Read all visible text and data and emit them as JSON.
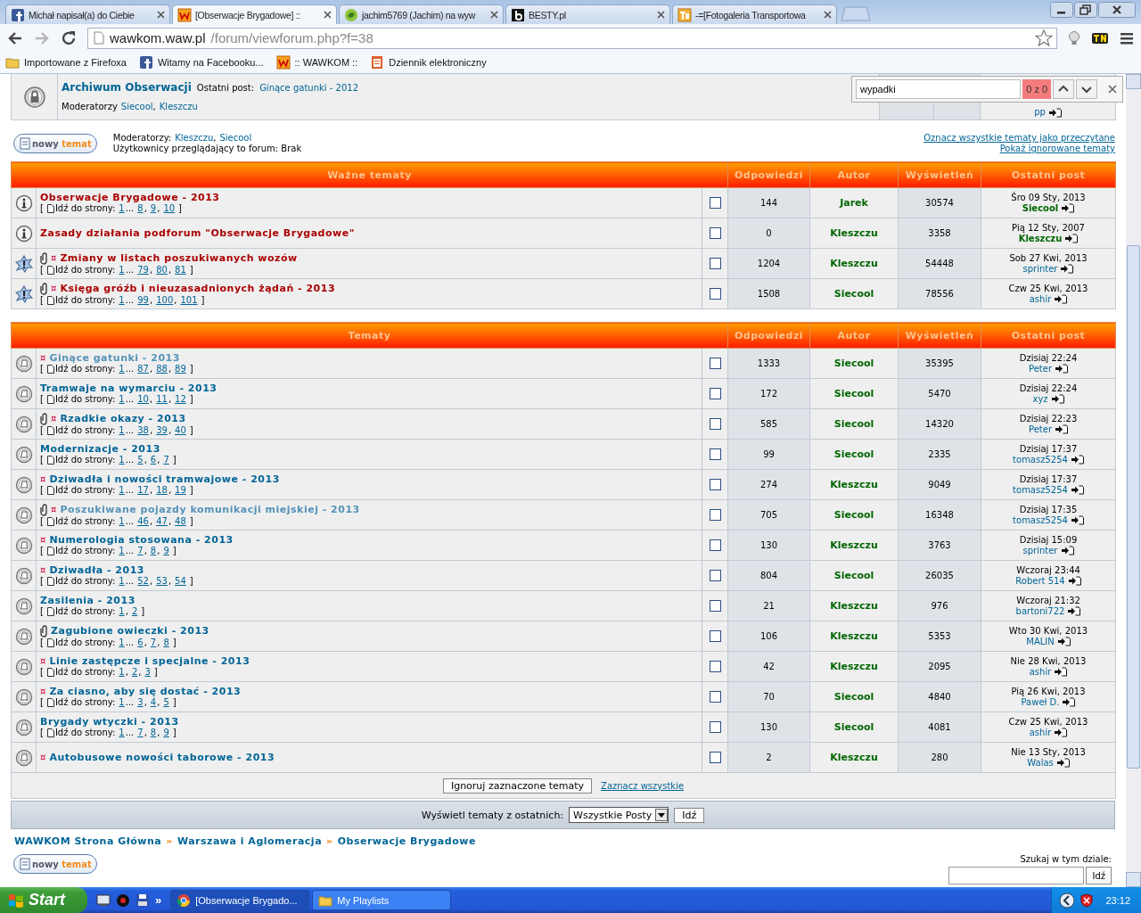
{
  "browser": {
    "tabs": [
      {
        "title": "Michał napisał(a) do Ciebie",
        "kind": "facebook",
        "selected": false
      },
      {
        "title": "[Obserwacje Brygadowe] ::",
        "kind": "wawkom",
        "selected": true
      },
      {
        "title": "jachim5769 (Jachim) na wyw",
        "kind": "green",
        "selected": false
      },
      {
        "title": "BESTY.pl",
        "kind": "b",
        "selected": false
      },
      {
        "title": "-=[Fotogaleria Transportowa",
        "kind": "tp",
        "selected": false
      }
    ],
    "address": {
      "host": "wawkom.waw.pl",
      "path": "/forum/viewforum.php?f=38"
    },
    "bookmarks": [
      {
        "label": "Importowane z Firefoxa",
        "kind": "folder"
      },
      {
        "label": "Witamy na Facebooku...",
        "kind": "facebook"
      },
      {
        "label": ":: WAWKOM ::",
        "kind": "wawkom"
      },
      {
        "label": "Dziennik elektroniczny",
        "kind": "dziennik"
      }
    ]
  },
  "find_bar": {
    "value": "wypadki",
    "count": "0 z 0"
  },
  "archive_forum": {
    "title": "Archiwum Obserwacji",
    "last_post_label": "Ostatni post:",
    "last_post": "Ginące gatunki - 2012",
    "moderators_label": "Moderatorzy",
    "moderators": [
      "Siecool",
      "Kleszczu"
    ],
    "separator": ",",
    "last_user": "pp"
  },
  "forum_info": {
    "new_topic": "nowy **temat**",
    "moderators_label": "Moderatorzy:",
    "moderators": [
      "Kleszczu",
      "Siecool"
    ],
    "separator": ",",
    "viewers": "Użytkownicy przeglądający to forum: Brak",
    "links": [
      "Oznacz wszystkie tematy jako przeczytane",
      "Pokaż ignorowane tematy"
    ]
  },
  "tables": [
    {
      "columns": [
        "Ważne tematy",
        "Odpowiedzi",
        "Autor",
        "Wyświetleń",
        "Ostatni post"
      ],
      "rows": [
        {
          "kind": "info",
          "attachment": false,
          "title": "Obserwacje Brygadowe - 2013",
          "visited": false,
          "pages": {
            "open": "[",
            "label": "Idź do strony:",
            "items": [
              {
                "t": "1",
                "link": true
              },
              {
                "t": "...",
                "link": false
              },
              {
                "t": "8",
                "link": true
              },
              {
                "t": ",",
                "link": false
              },
              {
                "t": "9",
                "link": true
              },
              {
                "t": ",",
                "link": false
              },
              {
                "t": "10",
                "link": true
              }
            ],
            "close": "]"
          },
          "checked": false,
          "replies": "144",
          "author": "Jarek",
          "views": "30574",
          "last_date": "Śro 09 Sty, 2013",
          "last_user": "Siecool",
          "moderator": true
        },
        {
          "kind": "info",
          "attachment": false,
          "title": "Zasady działania podforum \"Obserwacje Brygadowe\"",
          "visited": false,
          "checked": false,
          "replies": "0",
          "author": "Kleszczu",
          "views": "3358",
          "last_date": "Pią 12 Sty, 2007",
          "last_user": "Kleszczu",
          "moderator": true
        },
        {
          "kind": "sticky",
          "attachment": true,
          "mark": "¤",
          "title": "Zmiany w listach poszukiwanych wozów",
          "visited": false,
          "pages": {
            "open": "[",
            "label": "Idź do strony:",
            "items": [
              {
                "t": "1",
                "link": true
              },
              {
                "t": "...",
                "link": false
              },
              {
                "t": "79",
                "link": true
              },
              {
                "t": ",",
                "link": false
              },
              {
                "t": "80",
                "link": true
              },
              {
                "t": ",",
                "link": false
              },
              {
                "t": "81",
                "link": true
              }
            ],
            "close": "]"
          },
          "checked": false,
          "replies": "1204",
          "author": "Kleszczu",
          "views": "54448",
          "last_date": "Sob 27 Kwi, 2013",
          "last_user": "sprinter",
          "moderator": false
        },
        {
          "kind": "sticky",
          "attachment": true,
          "mark": "¤",
          "title": "Księga gróźb i nieuzasadnionych żądań - 2013",
          "visited": false,
          "pages": {
            "open": "[",
            "label": "Idź do strony:",
            "items": [
              {
                "t": "1",
                "link": true
              },
              {
                "t": "...",
                "link": false
              },
              {
                "t": "99",
                "link": true
              },
              {
                "t": ",",
                "link": false
              },
              {
                "t": "100",
                "link": true
              },
              {
                "t": ",",
                "link": false
              },
              {
                "t": "101",
                "link": true
              }
            ],
            "close": "]"
          },
          "checked": false,
          "replies": "1508",
          "author": "Siecool",
          "views": "78556",
          "last_date": "Czw 25 Kwi, 2013",
          "last_user": "ashir",
          "moderator": false
        }
      ]
    },
    {
      "columns": [
        "Tematy",
        "Odpowiedzi",
        "Autor",
        "Wyświetleń",
        "Ostatni post"
      ],
      "rows": [
        {
          "kind": "topic",
          "attachment": false,
          "mark": "¤",
          "title": "Ginące gatunki - 2013",
          "visited": true,
          "pages": {
            "open": "[",
            "label": "Idź do strony:",
            "items": [
              {
                "t": "1",
                "link": true
              },
              {
                "t": "...",
                "link": false
              },
              {
                "t": "87",
                "link": true
              },
              {
                "t": ",",
                "link": false
              },
              {
                "t": "88",
                "link": true
              },
              {
                "t": ",",
                "link": false
              },
              {
                "t": "89",
                "link": true
              }
            ],
            "close": "]"
          },
          "checked": false,
          "replies": "1333",
          "author": "Siecool",
          "views": "35395",
          "last_date": "Dzisiaj 22:24",
          "last_user": "Peter",
          "moderator": false
        },
        {
          "kind": "topic",
          "attachment": false,
          "title": "Tramwaje na wymarciu - 2013",
          "visited": false,
          "pages": {
            "open": "[",
            "label": "Idź do strony:",
            "items": [
              {
                "t": "1",
                "link": true
              },
              {
                "t": "...",
                "link": false
              },
              {
                "t": "10",
                "link": true
              },
              {
                "t": ",",
                "link": false
              },
              {
                "t": "11",
                "link": true
              },
              {
                "t": ",",
                "link": false
              },
              {
                "t": "12",
                "link": true
              }
            ],
            "close": "]"
          },
          "checked": false,
          "replies": "172",
          "author": "Siecool",
          "views": "5470",
          "last_date": "Dzisiaj 22:24",
          "last_user": "xyz",
          "moderator": false
        },
        {
          "kind": "topic",
          "attachment": true,
          "mark": "¤",
          "title": "Rzadkie okazy - 2013",
          "visited": false,
          "pages": {
            "open": "[",
            "label": "Idź do strony:",
            "items": [
              {
                "t": "1",
                "link": true
              },
              {
                "t": "...",
                "link": false
              },
              {
                "t": "38",
                "link": true
              },
              {
                "t": ",",
                "link": false
              },
              {
                "t": "39",
                "link": true
              },
              {
                "t": ",",
                "link": false
              },
              {
                "t": "40",
                "link": true
              }
            ],
            "close": "]"
          },
          "checked": false,
          "replies": "585",
          "author": "Siecool",
          "views": "14320",
          "last_date": "Dzisiaj 22:23",
          "last_user": "Peter",
          "moderator": false
        },
        {
          "kind": "topic",
          "attachment": false,
          "title": "Modernizacje - 2013",
          "visited": false,
          "pages": {
            "open": "[",
            "label": "Idź do strony:",
            "items": [
              {
                "t": "1",
                "link": true
              },
              {
                "t": "...",
                "link": false
              },
              {
                "t": "5",
                "link": true
              },
              {
                "t": ",",
                "link": false
              },
              {
                "t": "6",
                "link": true
              },
              {
                "t": ",",
                "link": false
              },
              {
                "t": "7",
                "link": true
              }
            ],
            "close": "]"
          },
          "checked": false,
          "replies": "99",
          "author": "Siecool",
          "views": "2335",
          "last_date": "Dzisiaj 17:37",
          "last_user": "tomasz5254",
          "moderator": false
        },
        {
          "kind": "topic",
          "attachment": false,
          "mark": "¤",
          "title": "Dziwadła i nowości tramwajowe - 2013",
          "visited": false,
          "pages": {
            "open": "[",
            "label": "Idź do strony:",
            "items": [
              {
                "t": "1",
                "link": true
              },
              {
                "t": "...",
                "link": false
              },
              {
                "t": "17",
                "link": true
              },
              {
                "t": ",",
                "link": false
              },
              {
                "t": "18",
                "link": true
              },
              {
                "t": ",",
                "link": false
              },
              {
                "t": "19",
                "link": true
              }
            ],
            "close": "]"
          },
          "checked": false,
          "replies": "274",
          "author": "Kleszczu",
          "views": "9049",
          "last_date": "Dzisiaj 17:37",
          "last_user": "tomasz5254",
          "moderator": false
        },
        {
          "kind": "topic",
          "attachment": true,
          "mark": "¤",
          "title": "Poszukiwane pojazdy komunikacji miejskiej - 2013",
          "visited": true,
          "pages": {
            "open": "[",
            "label": "Idź do strony:",
            "items": [
              {
                "t": "1",
                "link": true
              },
              {
                "t": "...",
                "link": false
              },
              {
                "t": "46",
                "link": true
              },
              {
                "t": ",",
                "link": false
              },
              {
                "t": "47",
                "link": true
              },
              {
                "t": ",",
                "link": false
              },
              {
                "t": "48",
                "link": true
              }
            ],
            "close": "]"
          },
          "checked": false,
          "replies": "705",
          "author": "Siecool",
          "views": "16348",
          "last_date": "Dzisiaj 17:35",
          "last_user": "tomasz5254",
          "moderator": false
        },
        {
          "kind": "topic",
          "attachment": false,
          "mark": "¤",
          "title": "Numerologia stosowana - 2013",
          "visited": false,
          "pages": {
            "open": "[",
            "label": "Idź do strony:",
            "items": [
              {
                "t": "1",
                "link": true
              },
              {
                "t": "...",
                "link": false
              },
              {
                "t": "7",
                "link": true
              },
              {
                "t": ",",
                "link": false
              },
              {
                "t": "8",
                "link": true
              },
              {
                "t": ",",
                "link": false
              },
              {
                "t": "9",
                "link": true
              }
            ],
            "close": "]"
          },
          "checked": false,
          "replies": "130",
          "author": "Kleszczu",
          "views": "3763",
          "last_date": "Dzisiaj 15:09",
          "last_user": "sprinter",
          "moderator": false
        },
        {
          "kind": "topic",
          "attachment": false,
          "mark": "¤",
          "title": "Dziwadła - 2013",
          "visited": false,
          "pages": {
            "open": "[",
            "label": "Idź do strony:",
            "items": [
              {
                "t": "1",
                "link": true
              },
              {
                "t": "...",
                "link": false
              },
              {
                "t": "52",
                "link": true
              },
              {
                "t": ",",
                "link": false
              },
              {
                "t": "53",
                "link": true
              },
              {
                "t": ",",
                "link": false
              },
              {
                "t": "54",
                "link": true
              }
            ],
            "close": "]"
          },
          "checked": false,
          "replies": "804",
          "author": "Siecool",
          "views": "26035",
          "last_date": "Wczoraj 23:44",
          "last_user": "Robert 514",
          "moderator": false
        },
        {
          "kind": "topic",
          "attachment": false,
          "title": "Zasilenia - 2013",
          "visited": false,
          "pages": {
            "open": "[",
            "label": "Idź do strony:",
            "items": [
              {
                "t": "1",
                "link": true
              },
              {
                "t": ",",
                "link": false
              },
              {
                "t": "2",
                "link": true
              }
            ],
            "close": "]"
          },
          "checked": false,
          "replies": "21",
          "author": "Kleszczu",
          "views": "976",
          "last_date": "Wczoraj 21:32",
          "last_user": "bartoni722",
          "moderator": false
        },
        {
          "kind": "topic",
          "attachment": true,
          "title": "Zagubione owieczki - 2013",
          "visited": false,
          "pages": {
            "open": "[",
            "label": "Idź do strony:",
            "items": [
              {
                "t": "1",
                "link": true
              },
              {
                "t": "...",
                "link": false
              },
              {
                "t": "6",
                "link": true
              },
              {
                "t": ",",
                "link": false
              },
              {
                "t": "7",
                "link": true
              },
              {
                "t": ",",
                "link": false
              },
              {
                "t": "8",
                "link": true
              }
            ],
            "close": "]"
          },
          "checked": false,
          "replies": "106",
          "author": "Kleszczu",
          "views": "5353",
          "last_date": "Wto 30 Kwi, 2013",
          "last_user": "MALIN",
          "moderator": false
        },
        {
          "kind": "topic",
          "attachment": false,
          "mark": "¤",
          "title": "Linie zastępcze i specjalne - 2013",
          "visited": false,
          "pages": {
            "open": "[",
            "label": "Idź do strony:",
            "items": [
              {
                "t": "1",
                "link": true
              },
              {
                "t": ",",
                "link": false
              },
              {
                "t": "2",
                "link": true
              },
              {
                "t": ",",
                "link": false
              },
              {
                "t": "3",
                "link": true
              }
            ],
            "close": "]"
          },
          "checked": false,
          "replies": "42",
          "author": "Kleszczu",
          "views": "2095",
          "last_date": "Nie 28 Kwi, 2013",
          "last_user": "ashir",
          "moderator": false
        },
        {
          "kind": "topic",
          "attachment": false,
          "mark": "¤",
          "title": "Za ciasno, aby się dostać - 2013",
          "visited": false,
          "pages": {
            "open": "[",
            "label": "Idź do strony:",
            "items": [
              {
                "t": "1",
                "link": true
              },
              {
                "t": "...",
                "link": false
              },
              {
                "t": "3",
                "link": true
              },
              {
                "t": ",",
                "link": false
              },
              {
                "t": "4",
                "link": true
              },
              {
                "t": ",",
                "link": false
              },
              {
                "t": "5",
                "link": true
              }
            ],
            "close": "]"
          },
          "checked": false,
          "replies": "70",
          "author": "Siecool",
          "views": "4840",
          "last_date": "Pią 26 Kwi, 2013",
          "last_user": "Paweł D.",
          "moderator": false
        },
        {
          "kind": "topic",
          "attachment": false,
          "title": "Brygady wtyczki - 2013",
          "visited": false,
          "pages": {
            "open": "[",
            "label": "Idź do strony:",
            "items": [
              {
                "t": "1",
                "link": true
              },
              {
                "t": "...",
                "link": false
              },
              {
                "t": "7",
                "link": true
              },
              {
                "t": ",",
                "link": false
              },
              {
                "t": "8",
                "link": true
              },
              {
                "t": ",",
                "link": false
              },
              {
                "t": "9",
                "link": true
              }
            ],
            "close": "]"
          },
          "checked": false,
          "replies": "130",
          "author": "Siecool",
          "views": "4081",
          "last_date": "Czw 25 Kwi, 2013",
          "last_user": "ashir",
          "moderator": false
        },
        {
          "kind": "topic",
          "attachment": false,
          "mark": "¤",
          "title": "Autobusowe nowości taborowe - 2013",
          "visited": false,
          "checked": false,
          "replies": "2",
          "author": "Kleszczu",
          "views": "280",
          "last_date": "Nie 13 Sty, 2013",
          "last_user": "Walas",
          "moderator": false
        }
      ]
    }
  ],
  "actions": {
    "ignore_button": "Ignoruj zaznaczone tematy",
    "select_all": "Zaznacz wszystkie"
  },
  "filter": {
    "label": "Wyświetl tematy z ostatnich:",
    "select": "Wszystkie Posty",
    "button": "Idź"
  },
  "breadcrumb": [
    {
      "t": "WAWKOM Strona Główna",
      "link": true
    },
    {
      "t": "»",
      "link": false
    },
    {
      "t": "Warszawa i Aglomeracja",
      "link": true
    },
    {
      "t": "»",
      "link": false
    },
    {
      "t": "Obserwacje Brygadowe",
      "link": true
    }
  ],
  "bottom": {
    "new_topic": "nowy **temat**",
    "search_label": "Szukaj w tym dziale:",
    "search_button": "Idź"
  },
  "taskbar": {
    "start": "Start",
    "more": "»",
    "tasks": [
      {
        "label": "[Obserwacje Brygado...",
        "kind": "chrome",
        "selected": true
      },
      {
        "label": "My Playlists",
        "kind": "folder",
        "selected": false
      }
    ],
    "clock": "23:12"
  }
}
